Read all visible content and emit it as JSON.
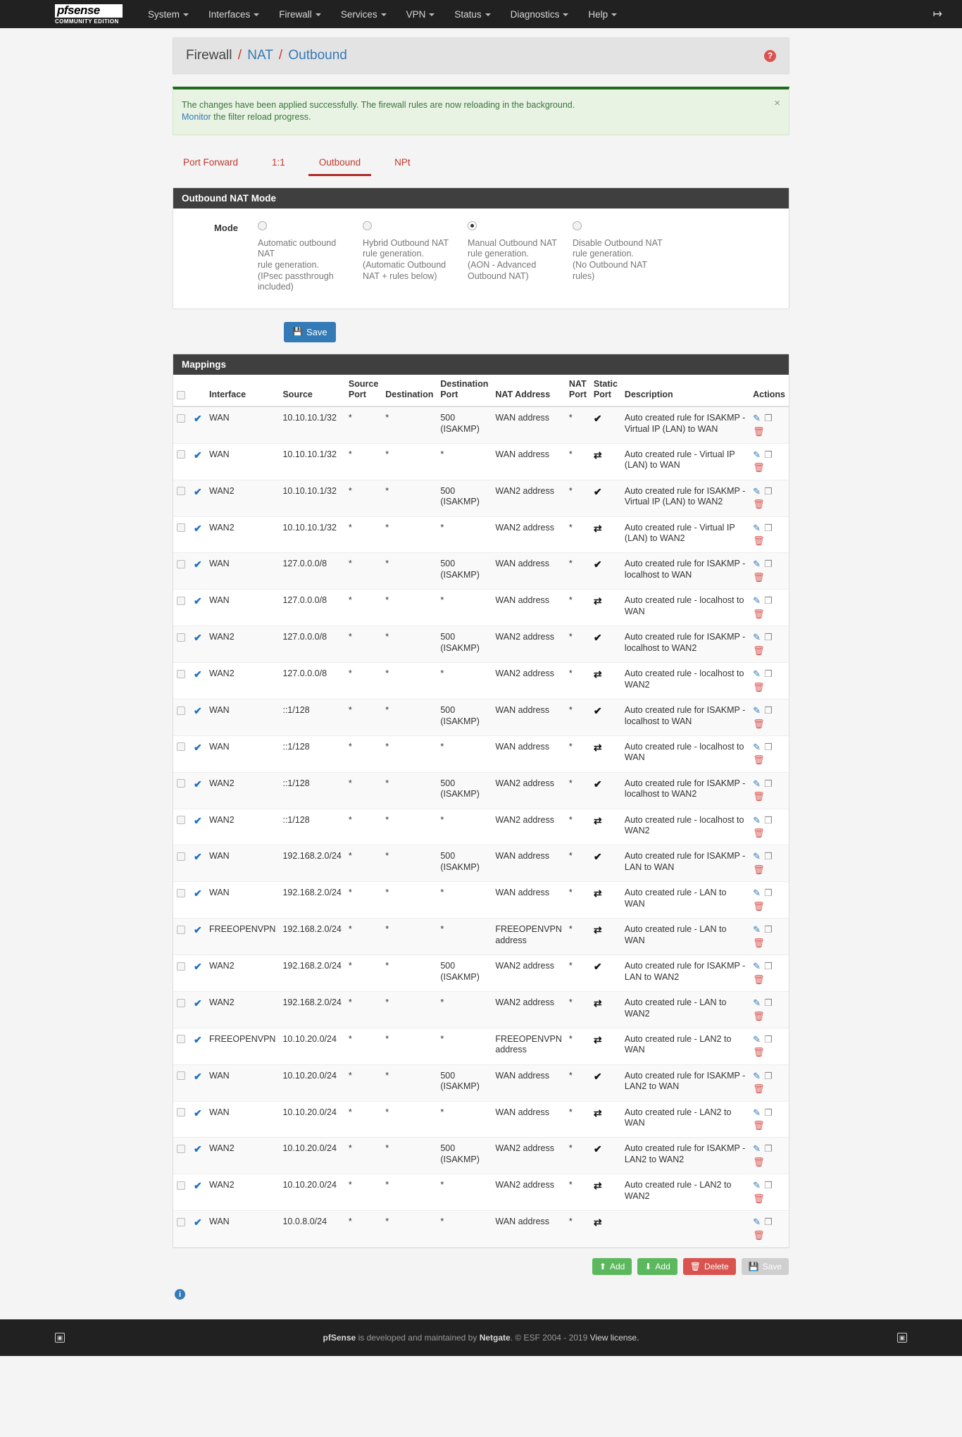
{
  "nav": {
    "brand": "pfsense",
    "brand_sub": "COMMUNITY EDITION",
    "items": [
      {
        "label": "System"
      },
      {
        "label": "Interfaces"
      },
      {
        "label": "Firewall"
      },
      {
        "label": "Services"
      },
      {
        "label": "VPN"
      },
      {
        "label": "Status"
      },
      {
        "label": "Diagnostics"
      },
      {
        "label": "Help"
      }
    ],
    "logout_icon": "logout-icon"
  },
  "breadcrumb": {
    "root": "Firewall",
    "sep": "/",
    "mid": "NAT",
    "leaf": "Outbound",
    "help": "?"
  },
  "alert": {
    "line1": "The changes have been applied successfully. The firewall rules are now reloading in the background.",
    "link": "Monitor",
    "line2_rest": " the filter reload progress.",
    "close": "×"
  },
  "tabs": [
    {
      "label": "Port Forward",
      "active": false
    },
    {
      "label": "1:1",
      "active": false
    },
    {
      "label": "Outbound",
      "active": true
    },
    {
      "label": "NPt",
      "active": false
    }
  ],
  "mode_panel": {
    "title": "Outbound NAT Mode",
    "label": "Mode",
    "options": [
      {
        "selected": false,
        "line1": "Automatic outbound NAT",
        "line2": "rule generation.",
        "line3": "(IPsec passthrough",
        "line4": "included)"
      },
      {
        "selected": false,
        "line1": "Hybrid Outbound NAT",
        "line2": "rule generation.",
        "line3": "(Automatic Outbound",
        "line4": "NAT + rules below)"
      },
      {
        "selected": true,
        "line1": "Manual Outbound NAT",
        "line2": "rule generation.",
        "line3": "(AON - Advanced",
        "line4": "Outbound NAT)"
      },
      {
        "selected": false,
        "line1": "Disable Outbound NAT",
        "line2": "rule generation.",
        "line3": "(No Outbound NAT rules)",
        "line4": ""
      }
    ],
    "save_label": "Save",
    "save_icon": "save-icon"
  },
  "mappings": {
    "title": "Mappings",
    "headers": {
      "interface": "Interface",
      "source": "Source",
      "source_port_1": "Source",
      "source_port_2": "Port",
      "destination": "Destination",
      "dest_port_1": "Destination",
      "dest_port_2": "Port",
      "nat_address": "NAT Address",
      "nat_port_1": "NAT",
      "nat_port_2": "Port",
      "static_port_1": "Static",
      "static_port_2": "Port",
      "description": "Description",
      "actions": "Actions"
    },
    "rows": [
      {
        "interface": "WAN",
        "source": "10.10.10.1/32",
        "source_port": "*",
        "destination": "*",
        "dest_port": "500 (ISAKMP)",
        "nat_address": "WAN address",
        "nat_port": "*",
        "static_port": "check",
        "description": "Auto created rule for ISAKMP - Virtual IP (LAN) to WAN"
      },
      {
        "interface": "WAN",
        "source": "10.10.10.1/32",
        "source_port": "*",
        "destination": "*",
        "dest_port": "*",
        "nat_address": "WAN address",
        "nat_port": "*",
        "static_port": "shuffle",
        "description": "Auto created rule - Virtual IP (LAN) to WAN"
      },
      {
        "interface": "WAN2",
        "source": "10.10.10.1/32",
        "source_port": "*",
        "destination": "*",
        "dest_port": "500 (ISAKMP)",
        "nat_address": "WAN2 address",
        "nat_port": "*",
        "static_port": "check",
        "description": "Auto created rule for ISAKMP - Virtual IP (LAN) to WAN2"
      },
      {
        "interface": "WAN2",
        "source": "10.10.10.1/32",
        "source_port": "*",
        "destination": "*",
        "dest_port": "*",
        "nat_address": "WAN2 address",
        "nat_port": "*",
        "static_port": "shuffle",
        "description": "Auto created rule - Virtual IP (LAN) to WAN2"
      },
      {
        "interface": "WAN",
        "source": "127.0.0.0/8",
        "source_port": "*",
        "destination": "*",
        "dest_port": "500 (ISAKMP)",
        "nat_address": "WAN address",
        "nat_port": "*",
        "static_port": "check",
        "description": "Auto created rule for ISAKMP - localhost to WAN"
      },
      {
        "interface": "WAN",
        "source": "127.0.0.0/8",
        "source_port": "*",
        "destination": "*",
        "dest_port": "*",
        "nat_address": "WAN address",
        "nat_port": "*",
        "static_port": "shuffle",
        "description": "Auto created rule - localhost to WAN"
      },
      {
        "interface": "WAN2",
        "source": "127.0.0.0/8",
        "source_port": "*",
        "destination": "*",
        "dest_port": "500 (ISAKMP)",
        "nat_address": "WAN2 address",
        "nat_port": "*",
        "static_port": "check",
        "description": "Auto created rule for ISAKMP - localhost to WAN2"
      },
      {
        "interface": "WAN2",
        "source": "127.0.0.0/8",
        "source_port": "*",
        "destination": "*",
        "dest_port": "*",
        "nat_address": "WAN2 address",
        "nat_port": "*",
        "static_port": "shuffle",
        "description": "Auto created rule - localhost to WAN2"
      },
      {
        "interface": "WAN",
        "source": "::1/128",
        "source_port": "*",
        "destination": "*",
        "dest_port": "500 (ISAKMP)",
        "nat_address": "WAN address",
        "nat_port": "*",
        "static_port": "check",
        "description": "Auto created rule for ISAKMP - localhost to WAN"
      },
      {
        "interface": "WAN",
        "source": "::1/128",
        "source_port": "*",
        "destination": "*",
        "dest_port": "*",
        "nat_address": "WAN address",
        "nat_port": "*",
        "static_port": "shuffle",
        "description": "Auto created rule - localhost to WAN"
      },
      {
        "interface": "WAN2",
        "source": "::1/128",
        "source_port": "*",
        "destination": "*",
        "dest_port": "500 (ISAKMP)",
        "nat_address": "WAN2 address",
        "nat_port": "*",
        "static_port": "check",
        "description": "Auto created rule for ISAKMP - localhost to WAN2"
      },
      {
        "interface": "WAN2",
        "source": "::1/128",
        "source_port": "*",
        "destination": "*",
        "dest_port": "*",
        "nat_address": "WAN2 address",
        "nat_port": "*",
        "static_port": "shuffle",
        "description": "Auto created rule - localhost to WAN2"
      },
      {
        "interface": "WAN",
        "source": "192.168.2.0/24",
        "source_port": "*",
        "destination": "*",
        "dest_port": "500 (ISAKMP)",
        "nat_address": "WAN address",
        "nat_port": "*",
        "static_port": "check",
        "description": "Auto created rule for ISAKMP - LAN to WAN"
      },
      {
        "interface": "WAN",
        "source": "192.168.2.0/24",
        "source_port": "*",
        "destination": "*",
        "dest_port": "*",
        "nat_address": "WAN address",
        "nat_port": "*",
        "static_port": "shuffle",
        "description": "Auto created rule - LAN to WAN"
      },
      {
        "interface": "FREEOPENVPN",
        "source": "192.168.2.0/24",
        "source_port": "*",
        "destination": "*",
        "dest_port": "*",
        "nat_address": "FREEOPENVPN address",
        "nat_port": "*",
        "static_port": "shuffle",
        "description": "Auto created rule - LAN to WAN"
      },
      {
        "interface": "WAN2",
        "source": "192.168.2.0/24",
        "source_port": "*",
        "destination": "*",
        "dest_port": "500 (ISAKMP)",
        "nat_address": "WAN2 address",
        "nat_port": "*",
        "static_port": "check",
        "description": "Auto created rule for ISAKMP - LAN to WAN2"
      },
      {
        "interface": "WAN2",
        "source": "192.168.2.0/24",
        "source_port": "*",
        "destination": "*",
        "dest_port": "*",
        "nat_address": "WAN2 address",
        "nat_port": "*",
        "static_port": "shuffle",
        "description": "Auto created rule - LAN to WAN2"
      },
      {
        "interface": "FREEOPENVPN",
        "source": "10.10.20.0/24",
        "source_port": "*",
        "destination": "*",
        "dest_port": "*",
        "nat_address": "FREEOPENVPN address",
        "nat_port": "*",
        "static_port": "shuffle",
        "description": "Auto created rule - LAN2 to WAN"
      },
      {
        "interface": "WAN",
        "source": "10.10.20.0/24",
        "source_port": "*",
        "destination": "*",
        "dest_port": "500 (ISAKMP)",
        "nat_address": "WAN address",
        "nat_port": "*",
        "static_port": "check",
        "description": "Auto created rule for ISAKMP - LAN2 to WAN"
      },
      {
        "interface": "WAN",
        "source": "10.10.20.0/24",
        "source_port": "*",
        "destination": "*",
        "dest_port": "*",
        "nat_address": "WAN address",
        "nat_port": "*",
        "static_port": "shuffle",
        "description": "Auto created rule - LAN2 to WAN"
      },
      {
        "interface": "WAN2",
        "source": "10.10.20.0/24",
        "source_port": "*",
        "destination": "*",
        "dest_port": "500 (ISAKMP)",
        "nat_address": "WAN2 address",
        "nat_port": "*",
        "static_port": "check",
        "description": "Auto created rule for ISAKMP - LAN2 to WAN2"
      },
      {
        "interface": "WAN2",
        "source": "10.10.20.0/24",
        "source_port": "*",
        "destination": "*",
        "dest_port": "*",
        "nat_address": "WAN2 address",
        "nat_port": "*",
        "static_port": "shuffle",
        "description": "Auto created rule - LAN2 to WAN2"
      },
      {
        "interface": "WAN",
        "source": "10.0.8.0/24",
        "source_port": "*",
        "destination": "*",
        "dest_port": "*",
        "nat_address": "WAN address",
        "nat_port": "*",
        "static_port": "shuffle",
        "description": ""
      }
    ]
  },
  "bottom_buttons": [
    {
      "label": "Add",
      "style": "success",
      "icon": "arrow-up-icon"
    },
    {
      "label": "Add",
      "style": "success",
      "icon": "arrow-down-icon"
    },
    {
      "label": "Delete",
      "style": "danger",
      "icon": "trash-icon"
    },
    {
      "label": "Save",
      "style": "default",
      "icon": "save-icon"
    }
  ],
  "footer": {
    "brand": "pfSense",
    "text1": " is developed and maintained by ",
    "netgate": "Netgate",
    "text2": ". © ESF 2004 - 2019 ",
    "license": "View license."
  },
  "colors": {
    "nav_bg": "#212121",
    "accent_red": "#c0392b",
    "link_blue": "#337ab7",
    "success_green": "#5cb85c",
    "danger_red": "#d9534f"
  }
}
